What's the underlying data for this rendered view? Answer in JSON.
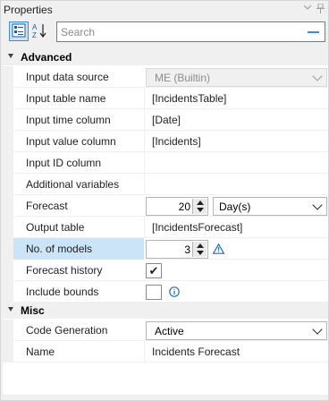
{
  "window": {
    "title": "Properties",
    "pin_icon": "pin-icon",
    "dropdown_icon": "chevron-down-icon"
  },
  "toolbar": {
    "categorized_icon": "categorized-view-icon",
    "alphabetical_icon": "alphabetical-sort-icon",
    "search_placeholder": "Search",
    "search_value": ""
  },
  "categories": {
    "advanced": "Advanced",
    "misc": "Misc"
  },
  "advanced": {
    "input_data_source": {
      "label": "Input data source",
      "value": "ME (Builtin)"
    },
    "input_table_name": {
      "label": "Input table name",
      "value": "[IncidentsTable]"
    },
    "input_time_column": {
      "label": "Input time column",
      "value": "[Date]"
    },
    "input_value_column": {
      "label": "Input value column",
      "value": "[Incidents]"
    },
    "input_id_column": {
      "label": "Input ID column",
      "value": ""
    },
    "additional_variables": {
      "label": "Additional variables",
      "value": ""
    },
    "forecast": {
      "label": "Forecast",
      "value": "20",
      "unit": "Day(s)"
    },
    "output_table": {
      "label": "Output table",
      "value": "[IncidentsForecast]"
    },
    "no_of_models": {
      "label": "No. of models",
      "value": "3"
    },
    "forecast_history": {
      "label": "Forecast history",
      "checked": "✔"
    },
    "include_bounds": {
      "label": "Include bounds",
      "checked": ""
    }
  },
  "misc": {
    "code_generation": {
      "label": "Code Generation",
      "value": "Active"
    },
    "name": {
      "label": "Name",
      "value": "Incidents Forecast"
    }
  },
  "colors": {
    "selected_row": "#cce4f7",
    "accent": "#3c8ad8",
    "warning": "#1f6fbf"
  }
}
